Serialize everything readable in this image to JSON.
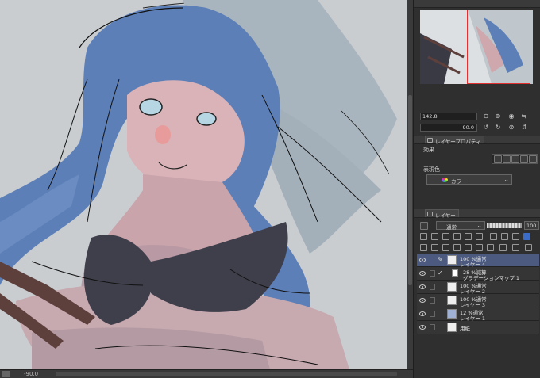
{
  "canvas": {
    "rotation_readout": "-90.0"
  },
  "navigator": {
    "zoom_value": "142.8",
    "rotation_value": "-90.0",
    "zoom_buttons": [
      "⊖",
      "⊕",
      "◉",
      "⇆"
    ],
    "rotate_buttons": [
      "↺",
      "↻",
      "⊘",
      "⇵"
    ]
  },
  "layer_property": {
    "tab_label": "レイヤープロパティ",
    "effect_label": "効果",
    "expression_color_label": "表現色",
    "expression_color_value": "カラー"
  },
  "layer_panel": {
    "tab_label": "レイヤー",
    "blend_mode": "通常",
    "opacity": "100",
    "layers": [
      {
        "mode": "100 %通常",
        "name": "レイヤー 4",
        "selected": true,
        "editing": true
      },
      {
        "mode": "28 %減算",
        "name": "グラデーションマップ 1",
        "selected": false,
        "correction": true
      },
      {
        "mode": "100 %通常",
        "name": "レイヤー 2",
        "selected": false
      },
      {
        "mode": "100 %通常",
        "name": "レイヤー 3",
        "selected": false
      },
      {
        "mode": "12 %通常",
        "name": "レイヤー 1",
        "selected": false
      },
      {
        "mode": "",
        "name": "用紙",
        "selected": false
      }
    ]
  }
}
